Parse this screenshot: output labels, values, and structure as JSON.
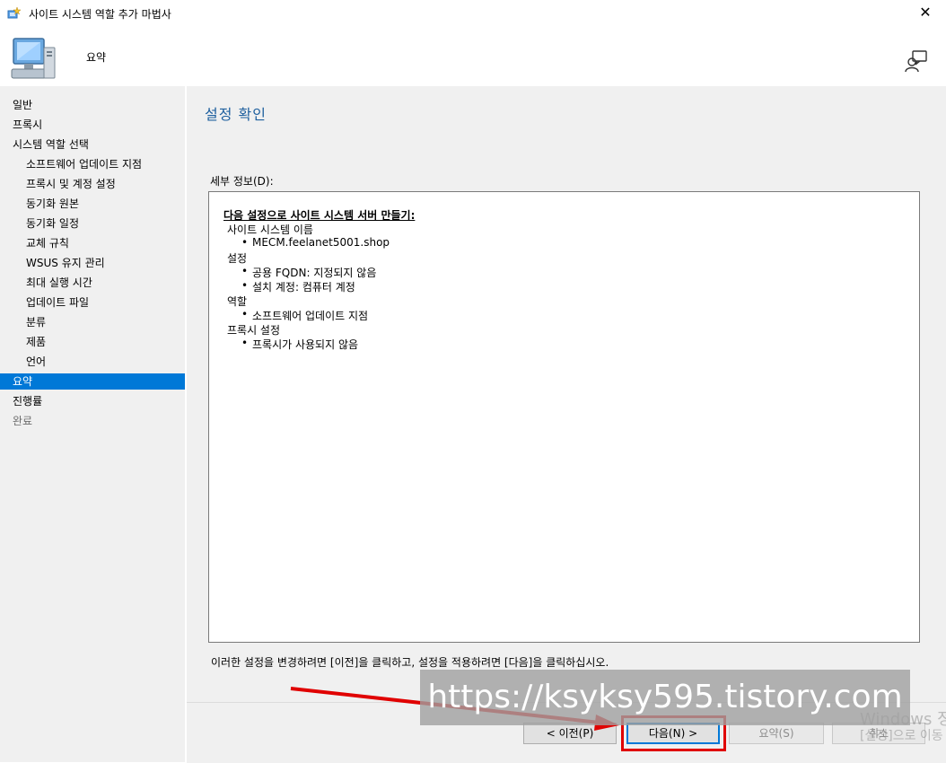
{
  "window": {
    "title": "사이트 시스템 역할 추가 마법사",
    "close_glyph": "✕"
  },
  "header": {
    "subtitle": "요약"
  },
  "nav": {
    "items": [
      {
        "label": "일반",
        "level": 0,
        "state": "normal"
      },
      {
        "label": "프록시",
        "level": 0,
        "state": "normal"
      },
      {
        "label": "시스템 역할 선택",
        "level": 0,
        "state": "normal"
      },
      {
        "label": "소프트웨어 업데이트 지점",
        "level": 1,
        "state": "normal"
      },
      {
        "label": "프록시 및 계정 설정",
        "level": 1,
        "state": "normal"
      },
      {
        "label": "동기화 원본",
        "level": 1,
        "state": "normal"
      },
      {
        "label": "동기화 일정",
        "level": 1,
        "state": "normal"
      },
      {
        "label": "교체 규칙",
        "level": 1,
        "state": "normal"
      },
      {
        "label": "WSUS 유지 관리",
        "level": 1,
        "state": "normal"
      },
      {
        "label": "최대 실행 시간",
        "level": 1,
        "state": "normal"
      },
      {
        "label": "업데이트 파일",
        "level": 1,
        "state": "normal"
      },
      {
        "label": "분류",
        "level": 1,
        "state": "normal"
      },
      {
        "label": "제품",
        "level": 1,
        "state": "normal"
      },
      {
        "label": "언어",
        "level": 1,
        "state": "normal"
      },
      {
        "label": "요약",
        "level": 0,
        "state": "active"
      },
      {
        "label": "진행률",
        "level": 0,
        "state": "normal"
      },
      {
        "label": "완료",
        "level": 0,
        "state": "disabled"
      }
    ]
  },
  "content": {
    "page_title": "설정 확인",
    "details_label": "세부 정보(D):",
    "details": {
      "heading": "다음 설정으로 사이트 시스템 서버 만들기:",
      "sections": [
        {
          "title": "사이트 시스템 이름",
          "bullets": [
            "MECM.feelanet5001.shop"
          ]
        },
        {
          "title": "설정",
          "bullets": [
            "공용 FQDN: 지정되지 않음",
            "설치 계정: 컴퓨터 계정"
          ]
        },
        {
          "title": "역할",
          "bullets": [
            "소프트웨어 업데이트 지점"
          ]
        },
        {
          "title": "프록시 설정",
          "bullets": [
            "프록시가 사용되지 않음"
          ]
        }
      ]
    },
    "hint": "이러한 설정을 변경하려면 [이전]을 클릭하고, 설정을 적용하려면 [다음]을 클릭하십시오."
  },
  "footer": {
    "prev_label": "< 이전(P)",
    "next_label": "다음(N) >",
    "summary_label": "요약(S)",
    "cancel_label": "취소"
  },
  "overlay": {
    "watermark": "https://ksyksy595.tistory.com",
    "windows_activation_line1": "Windows 정",
    "windows_activation_line2": "[설정]으로 이동",
    "annotation_color": "#e00000"
  }
}
